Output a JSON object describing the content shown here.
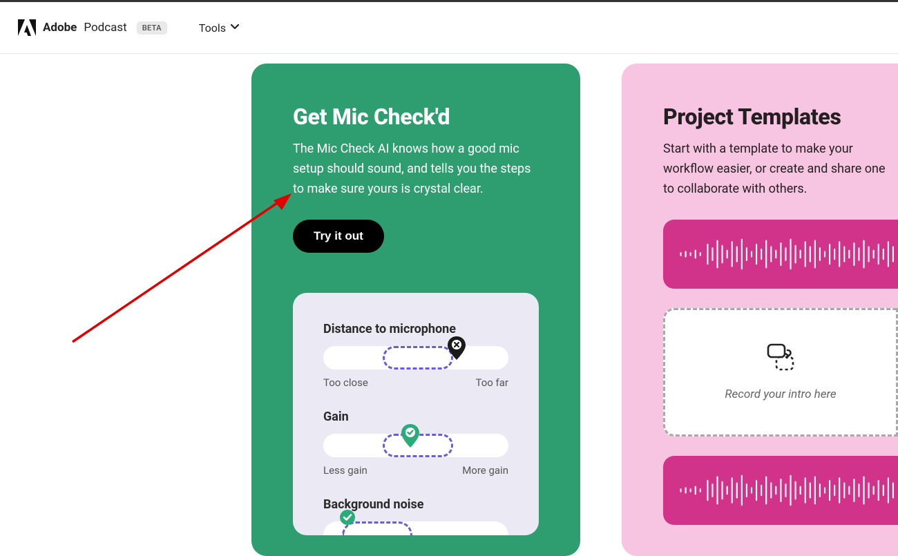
{
  "header": {
    "brand_strong": "Adobe",
    "brand_light": "Podcast",
    "beta": "BETA",
    "tools": "Tools"
  },
  "green": {
    "title": "Get Mic Check'd",
    "desc": "The Mic Check AI knows how a good mic setup should sound, and tells you the steps to make sure yours is crystal clear.",
    "cta": "Try it out",
    "m1": {
      "label": "Distance to microphone",
      "left": "Too close",
      "right": "Too far"
    },
    "m2": {
      "label": "Gain",
      "left": "Less gain",
      "right": "More gain"
    },
    "m3": {
      "label": "Background noise"
    }
  },
  "pink": {
    "title": "Project Templates",
    "desc": "Start with a template to make your workflow easier, or create and share one to collaborate with others.",
    "record_caption": "Record your intro here"
  }
}
